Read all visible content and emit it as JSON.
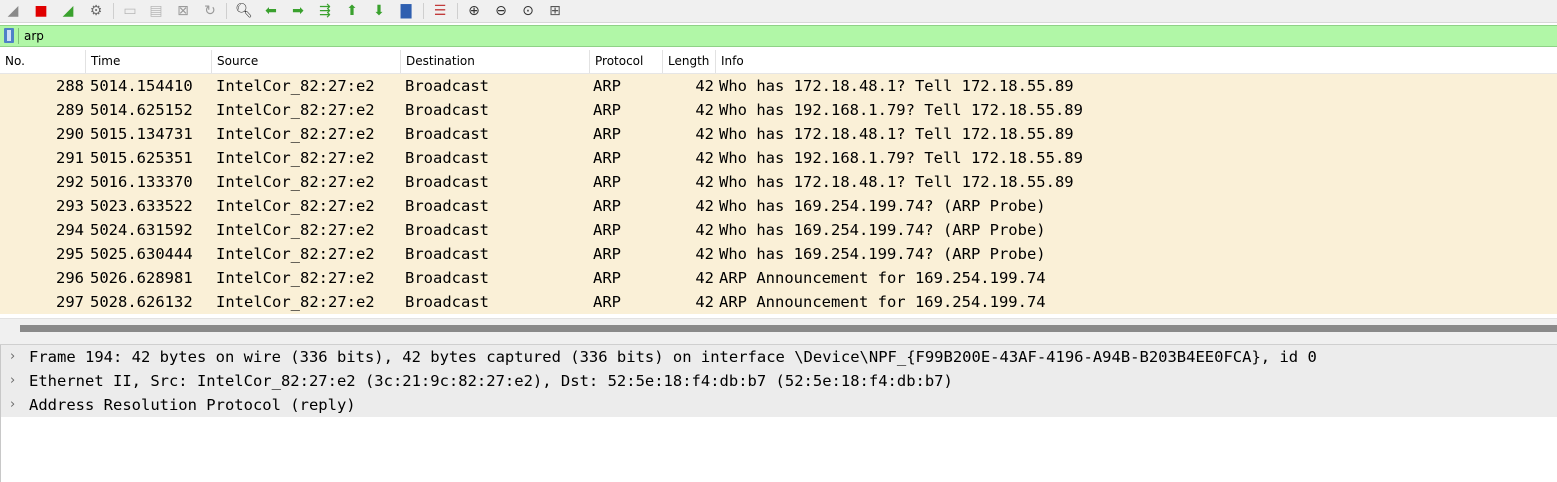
{
  "toolbar": {
    "buttons": [
      {
        "name": "shark-fin-start-icon",
        "glyph": "◢",
        "color": "#8a8a8a",
        "disabled": false
      },
      {
        "name": "stop-capture-icon",
        "glyph": "■",
        "color": "#e00000",
        "disabled": false
      },
      {
        "name": "restart-capture-icon",
        "glyph": "◢",
        "color": "#3aa12e",
        "disabled": false
      },
      {
        "name": "capture-options-gear-icon",
        "glyph": "⚙",
        "color": "#6b6b6b",
        "disabled": false
      },
      {
        "name": "open-file-icon",
        "glyph": "▭",
        "color": "#b7b7b7",
        "disabled": true
      },
      {
        "name": "save-file-icon",
        "glyph": "▤",
        "color": "#b7b7b7",
        "disabled": true
      },
      {
        "name": "close-file-icon",
        "glyph": "⊠",
        "color": "#9a9a9a",
        "disabled": true
      },
      {
        "name": "reload-file-icon",
        "glyph": "↻",
        "color": "#9a9a9a",
        "disabled": true
      },
      {
        "name": "find-packet-icon",
        "glyph": "🔍︎",
        "color": "#333333",
        "disabled": false
      },
      {
        "name": "go-back-icon",
        "glyph": "⬅",
        "color": "#3aa12e",
        "disabled": false
      },
      {
        "name": "go-forward-icon",
        "glyph": "➡",
        "color": "#3aa12e",
        "disabled": false
      },
      {
        "name": "go-to-packet-icon",
        "glyph": "⇶",
        "color": "#3aa12e",
        "disabled": false
      },
      {
        "name": "first-packet-icon",
        "glyph": "⬆",
        "color": "#3aa12e",
        "disabled": false
      },
      {
        "name": "last-packet-icon",
        "glyph": "⬇",
        "color": "#3aa12e",
        "disabled": false
      },
      {
        "name": "autoscroll-icon",
        "glyph": "▇",
        "color": "#2f5fb0",
        "disabled": false
      },
      {
        "name": "colorize-icon",
        "glyph": "☰",
        "color": "#c23b3b",
        "disabled": false
      },
      {
        "name": "zoom-in-icon",
        "glyph": "⊕",
        "color": "#333333",
        "disabled": false
      },
      {
        "name": "zoom-out-icon",
        "glyph": "⊖",
        "color": "#333333",
        "disabled": false
      },
      {
        "name": "normal-size-icon",
        "glyph": "⊙",
        "color": "#333333",
        "disabled": false
      },
      {
        "name": "resize-columns-icon",
        "glyph": "⊞",
        "color": "#555555",
        "disabled": false
      }
    ]
  },
  "filter": {
    "value": "arp",
    "background": "#b1f7a7"
  },
  "packet_list": {
    "columns": [
      "No.",
      "Time",
      "Source",
      "Destination",
      "Protocol",
      "Length",
      "Info"
    ],
    "row_color": "#faf0d7",
    "rows": [
      {
        "no": "288",
        "time": "5014.154410",
        "source": "IntelCor_82:27:e2",
        "destination": "Broadcast",
        "protocol": "ARP",
        "length": "42",
        "info": "Who has 172.18.48.1? Tell 172.18.55.89"
      },
      {
        "no": "289",
        "time": "5014.625152",
        "source": "IntelCor_82:27:e2",
        "destination": "Broadcast",
        "protocol": "ARP",
        "length": "42",
        "info": "Who has 192.168.1.79? Tell 172.18.55.89"
      },
      {
        "no": "290",
        "time": "5015.134731",
        "source": "IntelCor_82:27:e2",
        "destination": "Broadcast",
        "protocol": "ARP",
        "length": "42",
        "info": "Who has 172.18.48.1? Tell 172.18.55.89"
      },
      {
        "no": "291",
        "time": "5015.625351",
        "source": "IntelCor_82:27:e2",
        "destination": "Broadcast",
        "protocol": "ARP",
        "length": "42",
        "info": "Who has 192.168.1.79? Tell 172.18.55.89"
      },
      {
        "no": "292",
        "time": "5016.133370",
        "source": "IntelCor_82:27:e2",
        "destination": "Broadcast",
        "protocol": "ARP",
        "length": "42",
        "info": "Who has 172.18.48.1? Tell 172.18.55.89"
      },
      {
        "no": "293",
        "time": "5023.633522",
        "source": "IntelCor_82:27:e2",
        "destination": "Broadcast",
        "protocol": "ARP",
        "length": "42",
        "info": "Who has 169.254.199.74? (ARP Probe)"
      },
      {
        "no": "294",
        "time": "5024.631592",
        "source": "IntelCor_82:27:e2",
        "destination": "Broadcast",
        "protocol": "ARP",
        "length": "42",
        "info": "Who has 169.254.199.74? (ARP Probe)"
      },
      {
        "no": "295",
        "time": "5025.630444",
        "source": "IntelCor_82:27:e2",
        "destination": "Broadcast",
        "protocol": "ARP",
        "length": "42",
        "info": "Who has 169.254.199.74? (ARP Probe)"
      },
      {
        "no": "296",
        "time": "5026.628981",
        "source": "IntelCor_82:27:e2",
        "destination": "Broadcast",
        "protocol": "ARP",
        "length": "42",
        "info": "ARP Announcement for 169.254.199.74"
      },
      {
        "no": "297",
        "time": "5028.626132",
        "source": "IntelCor_82:27:e2",
        "destination": "Broadcast",
        "protocol": "ARP",
        "length": "42",
        "info": "ARP Announcement for 169.254.199.74"
      }
    ]
  },
  "details": {
    "expand_icon": "chevron-right-icon",
    "items": [
      {
        "text": "Frame 194: 42 bytes on wire (336 bits), 42 bytes captured (336 bits) on interface \\Device\\NPF_{F99B200E-43AF-4196-A94B-B203B4EE0FCA}, id 0"
      },
      {
        "text": "Ethernet II, Src: IntelCor_82:27:e2 (3c:21:9c:82:27:e2), Dst: 52:5e:18:f4:db:b7 (52:5e:18:f4:db:b7)"
      },
      {
        "text": "Address Resolution Protocol (reply)"
      }
    ]
  }
}
